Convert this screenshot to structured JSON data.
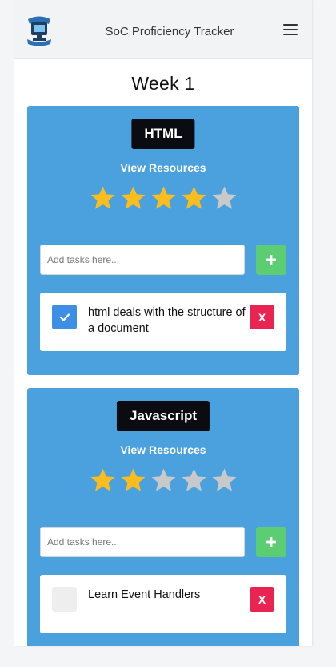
{
  "app": {
    "title": "SoC Proficiency Tracker"
  },
  "week": {
    "title": "Week 1"
  },
  "colors": {
    "card": "#4aa1dd",
    "badge": "#0a0c12",
    "star_filled": "#fbbd1e",
    "star_empty": "#c9c9c9",
    "add": "#5ccd73",
    "delete": "#ea2452",
    "check": "#3d8fe5"
  },
  "topics": [
    {
      "name": "HTML",
      "resources_label": "View Resources",
      "rating": 4,
      "rating_max": 5,
      "input_placeholder": "Add tasks here...",
      "add_label": "+",
      "tasks": [
        {
          "text": "html deals with the structure of a document",
          "done": true,
          "delete_label": "X"
        }
      ]
    },
    {
      "name": "Javascript",
      "resources_label": "View Resources",
      "rating": 2,
      "rating_max": 5,
      "input_placeholder": "Add tasks here...",
      "add_label": "+",
      "tasks": [
        {
          "text": "Learn Event Handlers",
          "done": false,
          "delete_label": "X"
        }
      ]
    }
  ]
}
